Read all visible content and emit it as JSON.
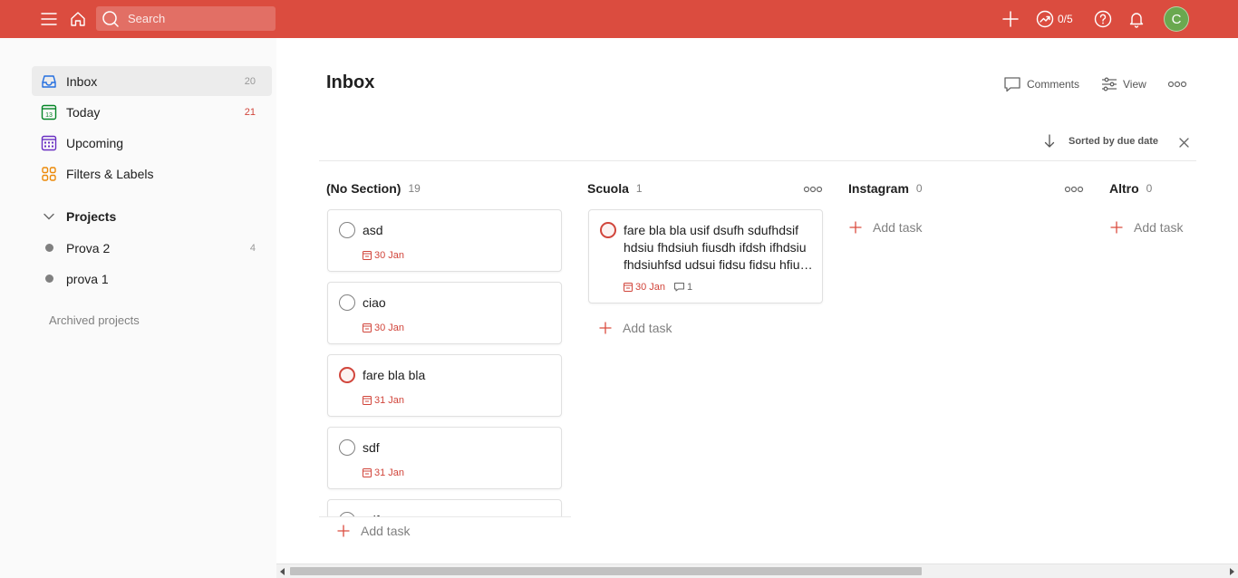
{
  "topbar": {
    "search_placeholder": "Search",
    "karma_label": "0/5",
    "avatar_initial": "C",
    "bg_color": "#db4c3f"
  },
  "sidebar": {
    "items": [
      {
        "label": "Inbox",
        "count": "20",
        "icon": "inbox-icon",
        "color": "#246fe0"
      },
      {
        "label": "Today",
        "count": "21",
        "icon": "calendar-today-icon",
        "color": "#058527"
      },
      {
        "label": "Upcoming",
        "count": "",
        "icon": "calendar-upcoming-icon",
        "color": "#692fc2"
      },
      {
        "label": "Filters & Labels",
        "count": "",
        "icon": "filters-icon",
        "color": "#eb8909"
      }
    ],
    "projects_title": "Projects",
    "projects": [
      {
        "label": "Prova 2",
        "count": "4"
      },
      {
        "label": "prova 1",
        "count": ""
      }
    ],
    "archived_label": "Archived projects"
  },
  "main": {
    "title": "Inbox",
    "actions": {
      "comments": "Comments",
      "view": "View"
    },
    "sort_label": "Sorted by due date",
    "add_task_label": "Add task",
    "columns": [
      {
        "name": "(No Section)",
        "count": "19",
        "tasks": [
          {
            "title": "asd",
            "due": "30 Jan",
            "priority": "none"
          },
          {
            "title": "ciao",
            "due": "30 Jan",
            "priority": "none"
          },
          {
            "title": "fare bla bla",
            "due": "31 Jan",
            "priority": "p1"
          },
          {
            "title": "sdf",
            "due": "31 Jan",
            "priority": "none"
          },
          {
            "title": "sdf",
            "due": "",
            "priority": "none"
          }
        ]
      },
      {
        "name": "Scuola",
        "count": "1",
        "tasks": [
          {
            "title": "fare bla bla usif dsufh sdufhdsif hdsiu fhdsiuh fiusdh ifdsh ifhdsiu fhdsiuhfsd udsui fidsu fidsu hfiu…",
            "due": "30 Jan",
            "comments": "1",
            "priority": "p1"
          }
        ]
      },
      {
        "name": "Instagram",
        "count": "0",
        "tasks": []
      },
      {
        "name": "Altro",
        "count": "0",
        "tasks": []
      }
    ]
  },
  "colors": {
    "accent": "#db4c3f",
    "due_red": "#d1453b"
  }
}
